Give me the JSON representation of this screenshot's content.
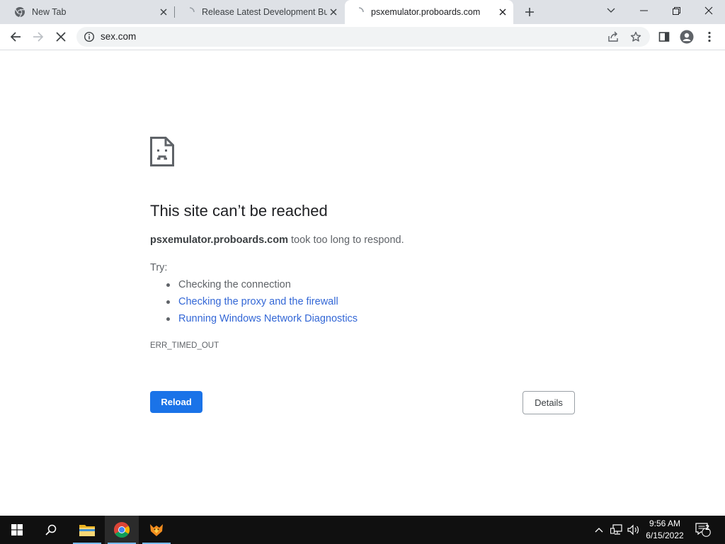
{
  "browser": {
    "tabs": [
      {
        "title": "New Tab",
        "favicon": "chrome-icon",
        "active": false
      },
      {
        "title": "Release Latest Development Buil",
        "favicon": "loading-spinner-icon",
        "active": false
      },
      {
        "title": "psxemulator.proboards.com",
        "favicon": "loading-spinner-icon",
        "active": true
      }
    ],
    "address_bar": {
      "url": "sex.com"
    }
  },
  "error_page": {
    "heading": "This site can’t be reached",
    "host": "psxemulator.proboards.com",
    "summary_rest": " took too long to respond.",
    "try_label": "Try:",
    "suggestions": [
      {
        "text": "Checking the connection",
        "link": false
      },
      {
        "text": "Checking the proxy and the firewall",
        "link": true
      },
      {
        "text": "Running Windows Network Diagnostics",
        "link": true
      }
    ],
    "error_code": "ERR_TIMED_OUT",
    "reload_label": "Reload",
    "details_label": "Details"
  },
  "taskbar": {
    "time": "9:56 AM",
    "date": "6/15/2022",
    "notification_count": "2"
  },
  "colors": {
    "accent": "#1a73e8",
    "link": "#3367d6",
    "tabstrip": "#dee1e6"
  }
}
